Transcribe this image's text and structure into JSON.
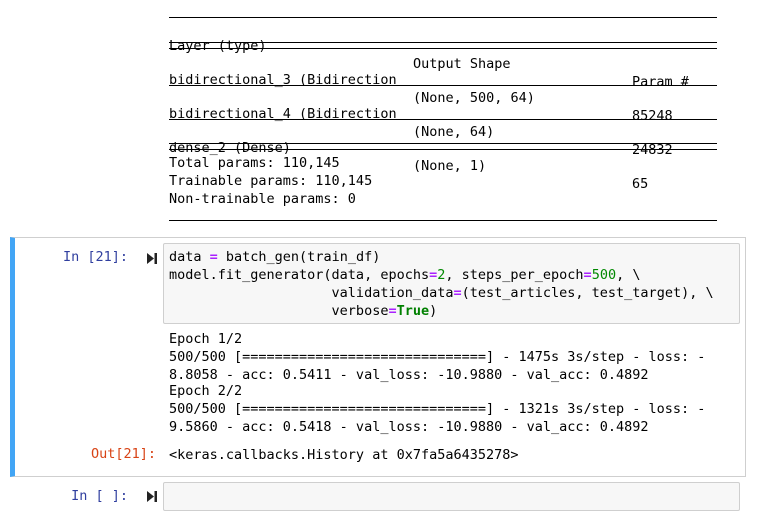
{
  "summary": {
    "header": {
      "layer": "Layer (type)",
      "shape": "Output Shape",
      "params": "Param #"
    },
    "rows": [
      {
        "layer": "bidirectional_3 (Bidirection",
        "shape": "(None, 500, 64)",
        "params": "85248"
      },
      {
        "layer": "bidirectional_4 (Bidirection",
        "shape": "(None, 64)",
        "params": "24832"
      },
      {
        "layer": "dense_2 (Dense)",
        "shape": "(None, 1)",
        "params": "65"
      }
    ],
    "total": "Total params: 110,145",
    "trainable": "Trainable params: 110,145",
    "non_trainable": "Non-trainable params: 0"
  },
  "cell21": {
    "prompt_in": "In [21]:",
    "code": {
      "l1_a": "data ",
      "l1_op": "=",
      "l1_b": " batch_gen(train_df)",
      "l2_a": "model.fit_generator(data, epochs",
      "l2_op1": "=",
      "l2_n1": "2",
      "l2_b": ", steps_per_epoch",
      "l2_op2": "=",
      "l2_n2": "500",
      "l2_c": ", \\",
      "l3_a": "                    validation_data",
      "l3_op": "=",
      "l3_b": "(test_articles, test_target), \\",
      "l4_a": "                    verbose",
      "l4_op": "=",
      "l4_kw": "True",
      "l4_b": ")"
    },
    "stream": [
      "Epoch 1/2",
      "500/500 [==============================] - 1475s 3s/step - loss: -",
      "8.8058 - acc: 0.5411 - val_loss: -10.9880 - val_acc: 0.4892",
      "Epoch 2/2",
      "500/500 [==============================] - 1321s 3s/step - loss: -",
      "9.5860 - acc: 0.5418 - val_loss: -10.9880 - val_acc: 0.4892"
    ],
    "prompt_out": "Out[21]:",
    "result": "<keras.callbacks.History at 0x7fa5a6435278>"
  },
  "empty_cell": {
    "prompt_in": "In [ ]:"
  },
  "colors": {
    "selected_border": "#42a5f5",
    "prompt_in": "#303f9f",
    "prompt_out": "#d84315",
    "keyword": "#008000",
    "operator": "#aa22ff"
  },
  "icons": {
    "run": "step-forward-icon"
  }
}
